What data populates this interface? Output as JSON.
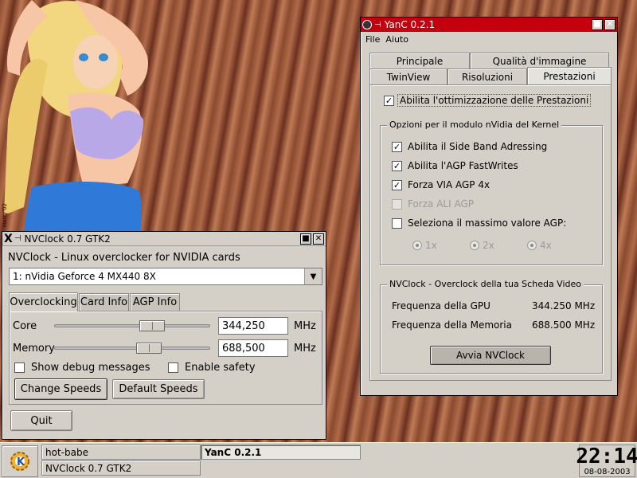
{
  "wallpaper": {
    "artist_signature": "Harry'02"
  },
  "nvclock": {
    "title": "NVClock 0.7 GTK2",
    "header": "NVClock - Linux overclocker for NVIDIA cards",
    "card_select": "1: nVidia Geforce 4 MX440 8X",
    "tabs": [
      "Overclocking",
      "Card Info",
      "AGP Info"
    ],
    "core": {
      "label": "Core",
      "value": "344,250",
      "unit": "MHz",
      "slider_fraction": 0.65
    },
    "memory": {
      "label": "Memory",
      "value": "688,500",
      "unit": "MHz",
      "slider_fraction": 0.63
    },
    "show_debug": {
      "label": "Show debug messages",
      "checked": false
    },
    "enable_safety": {
      "label": "Enable safety",
      "checked": false
    },
    "change_speeds": "Change Speeds",
    "default_speeds": "Default Speeds",
    "quit": "Quit"
  },
  "yanc": {
    "title": "YanC 0.2.1",
    "menu": [
      "File",
      "Aiuto"
    ],
    "tabs_row1": [
      "Principale",
      "Qualità d'immagine"
    ],
    "tabs_row2": [
      "TwinView",
      "Risoluzioni",
      "Prestazioni"
    ],
    "enable_perf": {
      "label": "Abilita l'ottimizzazione delle Prestazioni",
      "checked": true
    },
    "kernel_group": {
      "title": "Opzioni per il modulo nVidia del Kernel",
      "side_band": {
        "label": "Abilita il Side Band Adressing",
        "checked": true
      },
      "fast_writes": {
        "label": "Abilita l'AGP FastWrites",
        "checked": true
      },
      "via_agp": {
        "label": "Forza VIA AGP 4x",
        "checked": true
      },
      "ali_agp": {
        "label": "Forza ALI AGP",
        "checked": false
      },
      "max_agp": {
        "label": "Seleziona il massimo valore AGP:",
        "checked": false
      },
      "radios": [
        "1x",
        "2x",
        "4x"
      ]
    },
    "oc_group": {
      "title": "NVClock - Overclock della tua Scheda Video",
      "gpu_label": "Frequenza della GPU",
      "gpu_value": "344.250 MHz",
      "mem_label": "Frequenza della Memoria",
      "mem_value": "688.500 MHz",
      "start_button": "Avvia NVClock"
    }
  },
  "taskbar": {
    "tasks": [
      "hot-babe",
      "NVClock 0.7 GTK2",
      "YanC 0.2.1"
    ],
    "clock_time": "22:14",
    "clock_date": "08-08-2003"
  }
}
